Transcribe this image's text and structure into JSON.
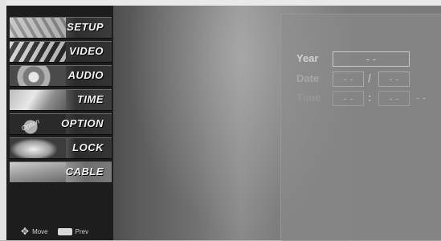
{
  "menu": {
    "items": [
      {
        "label": "SETUP"
      },
      {
        "label": "VIDEO"
      },
      {
        "label": "AUDIO"
      },
      {
        "label": "TIME"
      },
      {
        "label": "OPTION"
      },
      {
        "label": "LOCK"
      },
      {
        "label": "CABLE"
      }
    ],
    "thumb_texts": {
      "option": "Option"
    }
  },
  "footer": {
    "move_label": "Move",
    "prev_label": "Prev",
    "move_icon": "dpad-icon",
    "prev_icon": "menu-key-icon"
  },
  "clock": {
    "year_label": "Year",
    "date_label": "Date",
    "time_label": "Time",
    "year_value": "- -",
    "month_value": "- -",
    "day_value": "- -",
    "hour_value": "- -",
    "minute_value": "- -",
    "date_separator": "/",
    "time_separator": ":",
    "ampm_value": "- -"
  }
}
